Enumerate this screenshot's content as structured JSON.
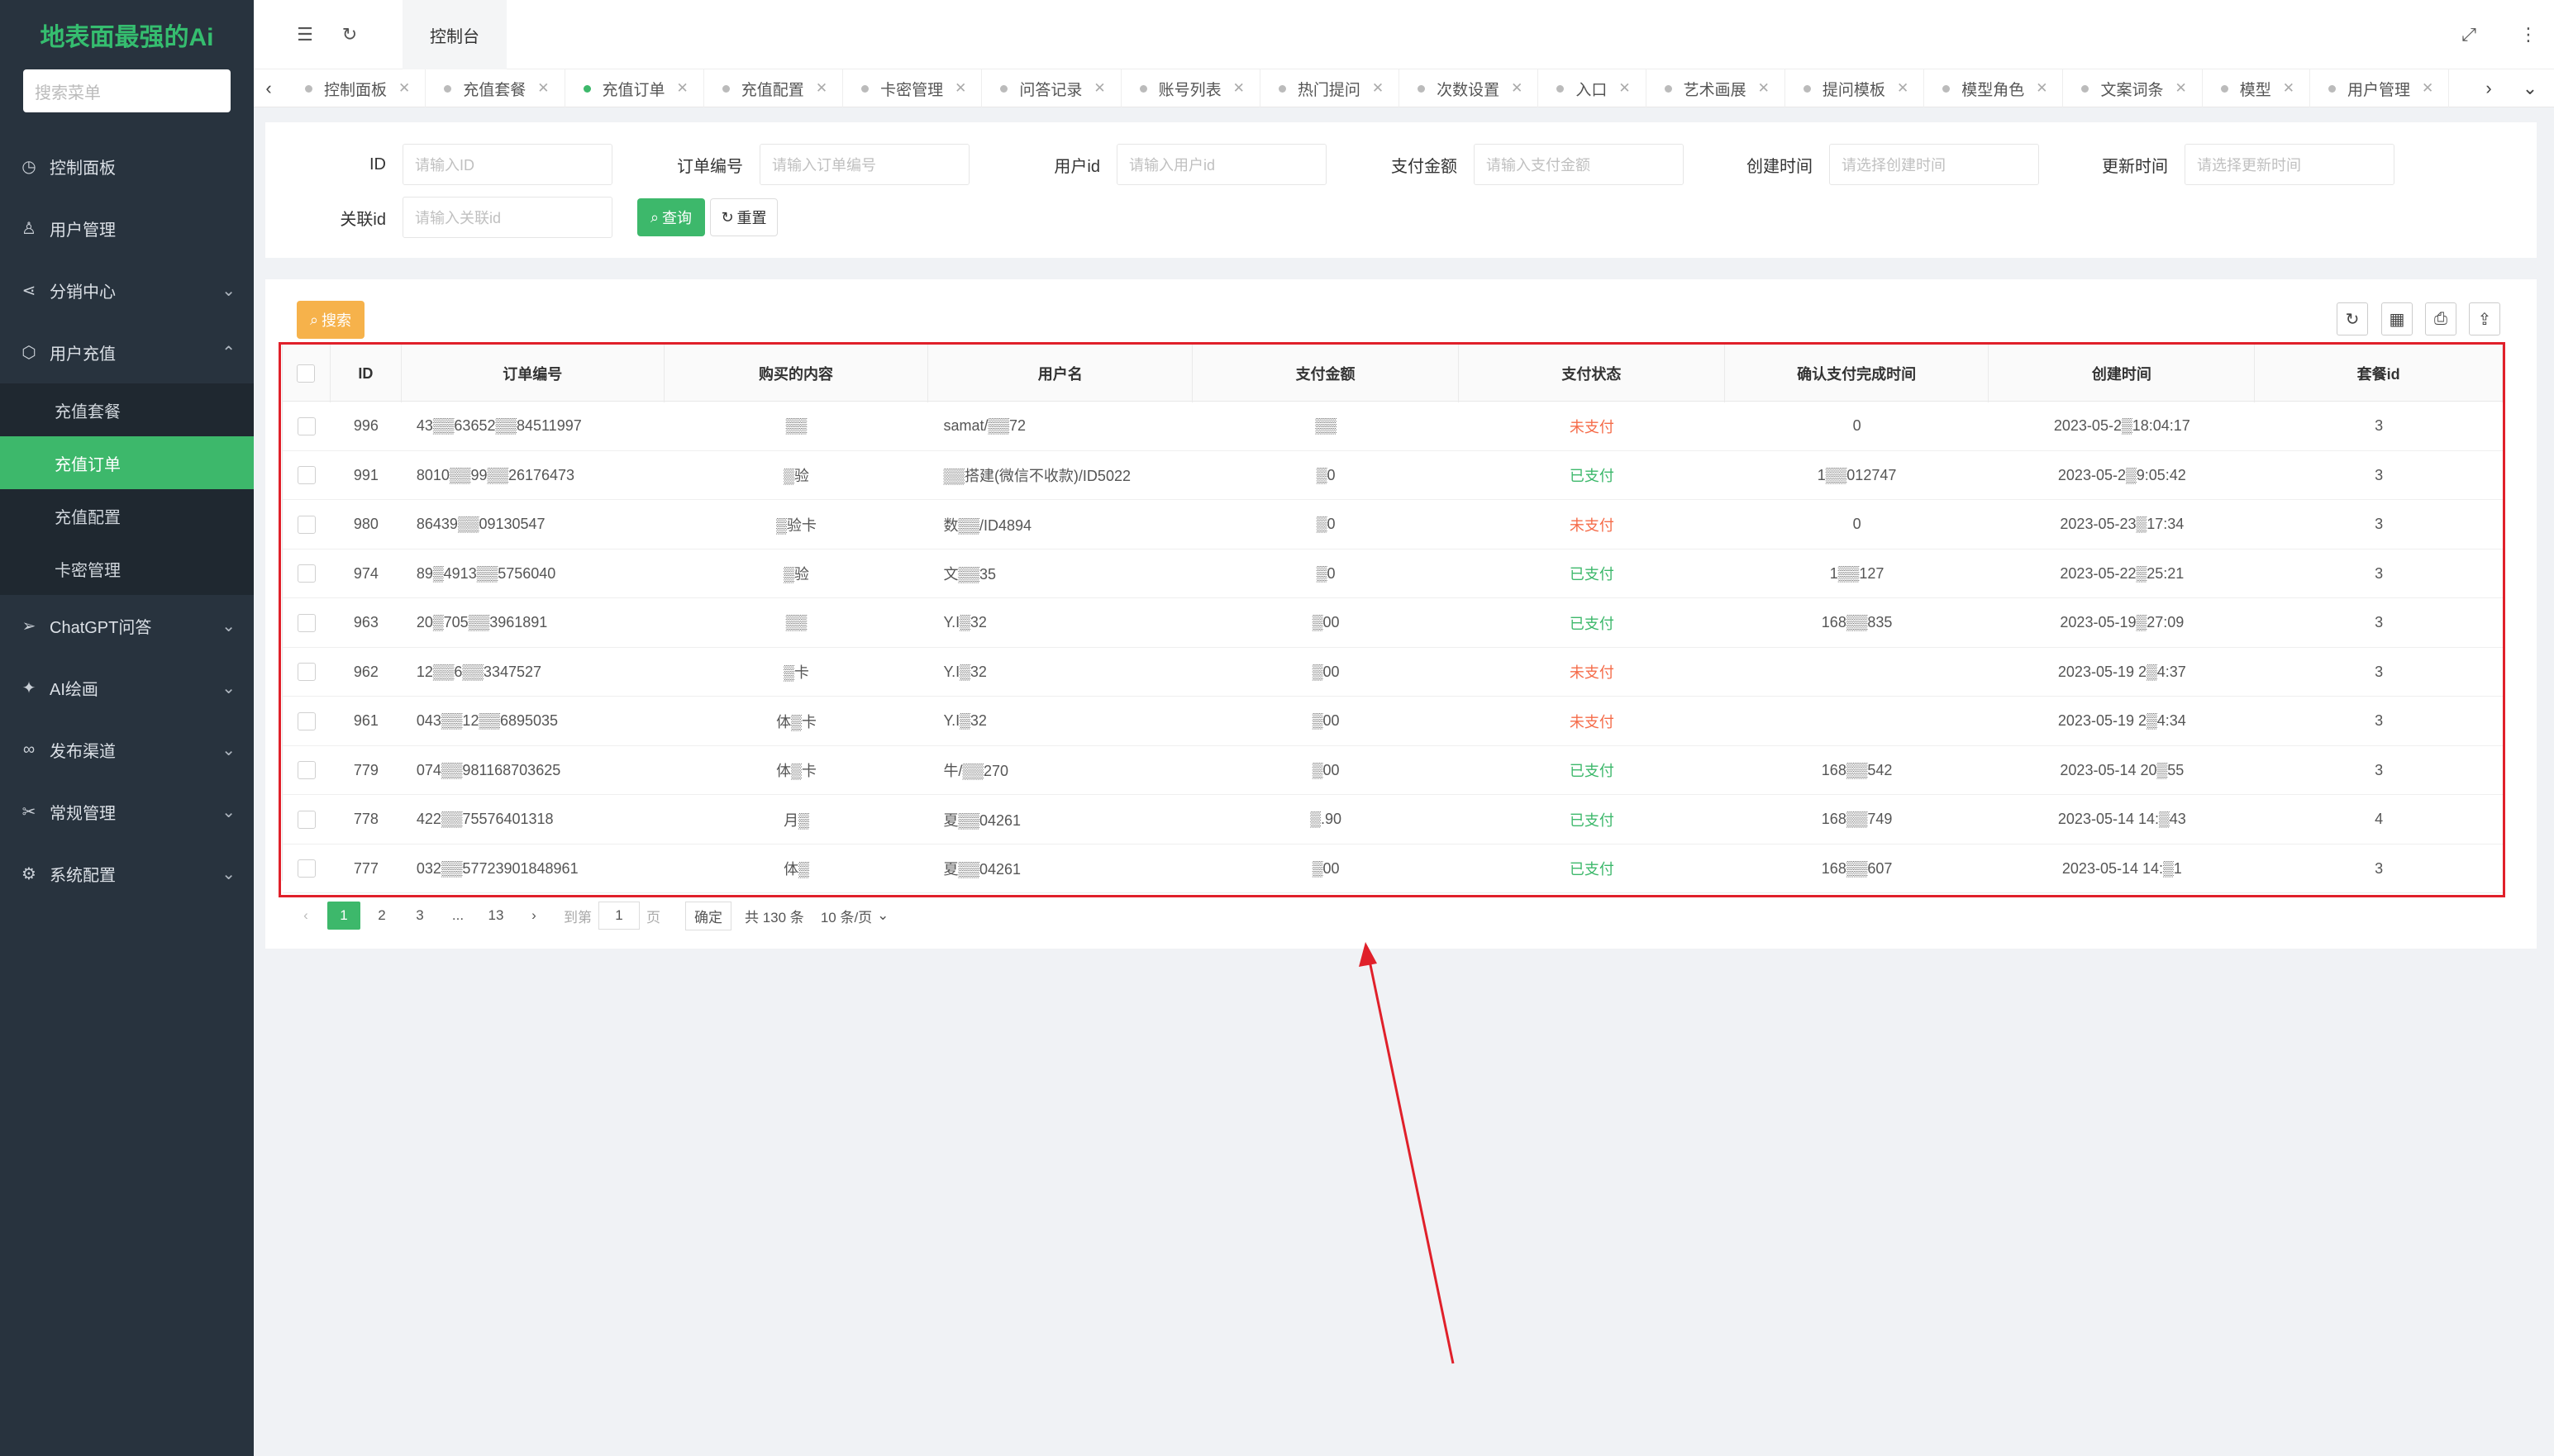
{
  "brand": "地表面最强的Ai",
  "sidebar": {
    "search_placeholder": "搜索菜单",
    "items": [
      {
        "label": "控制面板",
        "icon": "dashboard-icon"
      },
      {
        "label": "用户管理",
        "icon": "user-icon"
      },
      {
        "label": "分销中心",
        "icon": "share-icon"
      },
      {
        "label": "用户充值",
        "icon": "box-icon"
      },
      {
        "label": "ChatGPT问答",
        "icon": "send-icon"
      },
      {
        "label": "AI绘画",
        "icon": "paint-icon"
      },
      {
        "label": "发布渠道",
        "icon": "link-icon"
      },
      {
        "label": "常规管理",
        "icon": "tools-icon"
      },
      {
        "label": "系统配置",
        "icon": "gear-icon"
      }
    ],
    "submenu": [
      "充值套餐",
      "充值订单",
      "充值配置",
      "卡密管理"
    ]
  },
  "header": {
    "tab": "控制台"
  },
  "tabs": [
    "控制面板",
    "充值套餐",
    "充值订单",
    "充值配置",
    "卡密管理",
    "问答记录",
    "账号列表",
    "热门提问",
    "次数设置",
    "入口",
    "艺术画展",
    "提问模板",
    "模型角色",
    "文案词条",
    "模型",
    "用户管理"
  ],
  "filters": {
    "id_label": "ID",
    "id_placeholder": "请输入ID",
    "order_label": "订单编号",
    "order_placeholder": "请输入订单编号",
    "user_label": "用户id",
    "user_placeholder": "请输入用户id",
    "amount_label": "支付金额",
    "amount_placeholder": "请输入支付金额",
    "created_label": "创建时间",
    "created_placeholder": "请选择创建时间",
    "updated_label": "更新时间",
    "updated_placeholder": "请选择更新时间",
    "related_label": "关联id",
    "related_placeholder": "请输入关联id",
    "query_label": "查询",
    "reset_label": "重置"
  },
  "table": {
    "search_label": "搜索",
    "columns": [
      "ID",
      "订单编号",
      "购买的内容",
      "用户名",
      "支付金额",
      "支付状态",
      "确认支付完成时间",
      "创建时间",
      "套餐id"
    ],
    "rows": [
      {
        "id": "996",
        "order": "43▒▒63652▒▒84511997",
        "content": "▒▒",
        "user": "samat/▒▒72",
        "amount": "▒▒",
        "status": "未支付",
        "paid_time": "0",
        "created": "2023-05-2▒18:04:17",
        "pkg": "3"
      },
      {
        "id": "991",
        "order": "8010▒▒99▒▒26176473",
        "content": "▒验",
        "user": "▒▒搭建(微信不收款)/ID5022",
        "amount": "▒0",
        "status": "已支付",
        "paid_time": "1▒▒012747",
        "created": "2023-05-2▒9:05:42",
        "pkg": "3"
      },
      {
        "id": "980",
        "order": "86439▒▒09130547",
        "content": "▒验卡",
        "user": "数▒▒/ID4894",
        "amount": "▒0",
        "status": "未支付",
        "paid_time": "0",
        "created": "2023-05-23▒17:34",
        "pkg": "3"
      },
      {
        "id": "974",
        "order": "89▒4913▒▒5756040",
        "content": "▒验",
        "user": "文▒▒35",
        "amount": "▒0",
        "status": "已支付",
        "paid_time": "1▒▒127",
        "created": "2023-05-22▒25:21",
        "pkg": "3"
      },
      {
        "id": "963",
        "order": "20▒705▒▒3961891",
        "content": "▒▒",
        "user": "Y.I▒32",
        "amount": "▒00",
        "status": "已支付",
        "paid_time": "168▒▒835",
        "created": "2023-05-19▒27:09",
        "pkg": "3"
      },
      {
        "id": "962",
        "order": "12▒▒6▒▒3347527",
        "content": "▒卡",
        "user": "Y.I▒32",
        "amount": "▒00",
        "status": "未支付",
        "paid_time": "",
        "created": "2023-05-19 2▒4:37",
        "pkg": "3"
      },
      {
        "id": "961",
        "order": "043▒▒12▒▒6895035",
        "content": "体▒卡",
        "user": "Y.I▒32",
        "amount": "▒00",
        "status": "未支付",
        "paid_time": "",
        "created": "2023-05-19 2▒4:34",
        "pkg": "3"
      },
      {
        "id": "779",
        "order": "074▒▒981168703625",
        "content": "体▒卡",
        "user": "牛/▒▒270",
        "amount": "▒00",
        "status": "已支付",
        "paid_time": "168▒▒542",
        "created": "2023-05-14 20▒55",
        "pkg": "3"
      },
      {
        "id": "778",
        "order": "422▒▒75576401318",
        "content": "月▒",
        "user": "夏▒▒04261",
        "amount": "▒.90",
        "status": "已支付",
        "paid_time": "168▒▒749",
        "created": "2023-05-14 14:▒43",
        "pkg": "4"
      },
      {
        "id": "777",
        "order": "032▒▒57723901848961",
        "content": "体▒",
        "user": "夏▒▒04261",
        "amount": "▒00",
        "status": "已支付",
        "paid_time": "168▒▒607",
        "created": "2023-05-14 14:▒1",
        "pkg": "3"
      }
    ]
  },
  "pager": {
    "pages": [
      "1",
      "2",
      "3",
      "...",
      "13"
    ],
    "goto_prefix": "到第",
    "goto_value": "1",
    "goto_suffix": "页",
    "confirm": "确定",
    "total": "共 130 条",
    "page_size": "10 条/页"
  },
  "colors": {
    "accent": "#3db86b",
    "sidebar": "#28333e",
    "warning": "#f6b24b",
    "highlight": "#e0202a"
  }
}
